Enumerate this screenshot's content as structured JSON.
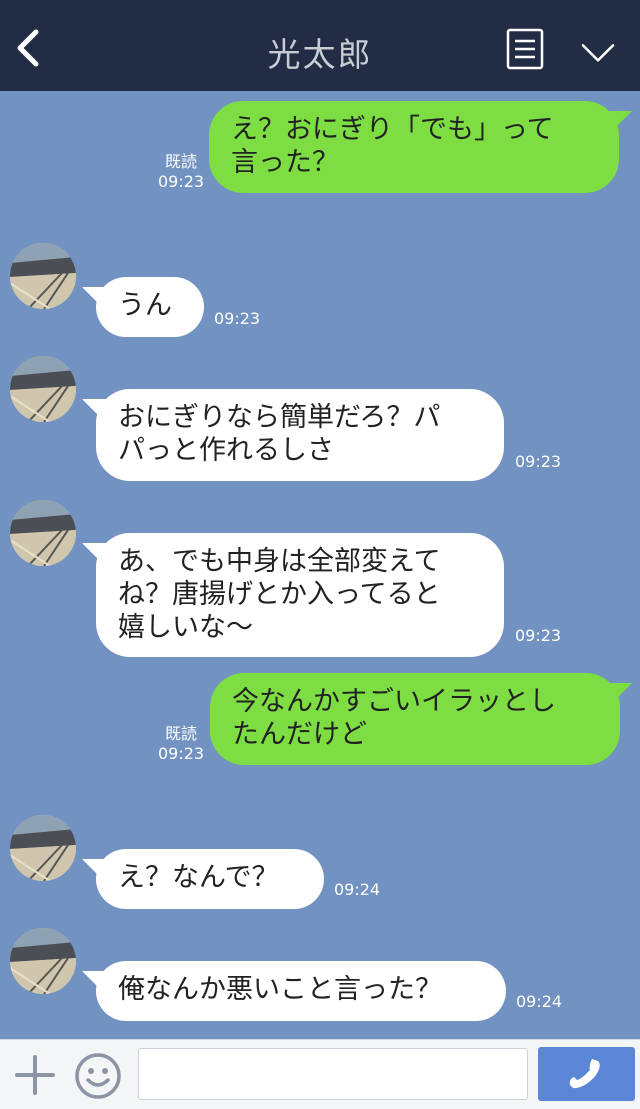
{
  "header": {
    "title": "光太郎",
    "back_icon": "chevron-left-icon",
    "menu_icon": "list-icon",
    "expand_icon": "chevron-down-icon",
    "bg_color": "#222c45"
  },
  "chat": {
    "bg_color": "#7292c1",
    "messages": [
      {
        "sender": "me",
        "lines": [
          "え？おにぎり「でも」って",
          "言った？"
        ],
        "read": "既読",
        "time": "09:23"
      },
      {
        "sender": "them",
        "lines": [
          "うん"
        ],
        "time": "09:23"
      },
      {
        "sender": "them",
        "lines": [
          "おにぎりなら簡単だろ？パ",
          "パっと作れるしさ"
        ],
        "time": "09:23"
      },
      {
        "sender": "them",
        "lines": [
          "あ、でも中身は全部変えて",
          "ね？唐揚げとか入ってると",
          "嬉しいな〜"
        ],
        "time": "09:23"
      },
      {
        "sender": "me",
        "lines": [
          "今なんかすごいイラッとし",
          "たんだけど"
        ],
        "read": "既読",
        "time": "09:23"
      },
      {
        "sender": "them",
        "lines": [
          "え？なんで？"
        ],
        "time": "09:24"
      },
      {
        "sender": "them",
        "lines": [
          "俺なんか悪いこと言った？"
        ],
        "time": "09:24"
      }
    ]
  },
  "input_bar": {
    "placeholder": "",
    "plus_icon": "plus-icon",
    "emoji_icon": "smiley-icon",
    "call_icon": "phone-icon",
    "call_color": "#5b86d6"
  }
}
